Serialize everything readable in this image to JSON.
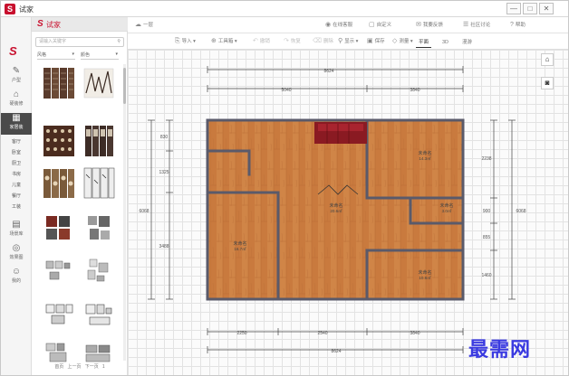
{
  "app": {
    "title": "试家",
    "logo_letter": "S"
  },
  "window_controls": [
    "—",
    "□",
    "✕"
  ],
  "sidebar": {
    "logo": "S",
    "items": [
      {
        "icon": "✎",
        "label": "户型"
      },
      {
        "icon": "⌂",
        "label": "硬装修"
      },
      {
        "icon": "▦",
        "label": "家居装"
      },
      {
        "icon": "▤",
        "label": "场景库"
      },
      {
        "icon": "◎",
        "label": "效果图"
      },
      {
        "icon": "☺",
        "label": "我的"
      }
    ],
    "sub_items": [
      "客厅",
      "卧室",
      "厨卫",
      "书房",
      "儿童",
      "餐厅",
      "工装"
    ]
  },
  "catalog": {
    "search_placeholder": "请输入关键字",
    "filter_style": "风格",
    "filter_color": "颜色",
    "pager": {
      "first": "首页",
      "prev": "上一页",
      "next": "下一页",
      "page": "1"
    }
  },
  "toolbar": {
    "project": "一层",
    "menu": [
      {
        "icon": "◉",
        "label": "在线客服"
      },
      {
        "icon": "▢",
        "label": "自定义"
      },
      {
        "icon": "✉",
        "label": "我要反馈"
      },
      {
        "icon": "☰",
        "label": "社区讨论"
      },
      {
        "icon": "?",
        "label": "帮助"
      }
    ],
    "tools": [
      {
        "icon": "⎘",
        "label": "导入",
        "dim": false
      },
      {
        "icon": "⊕",
        "label": "工具箱",
        "dim": false
      },
      {
        "icon": "↶",
        "label": "撤销",
        "dim": true
      },
      {
        "icon": "↷",
        "label": "恢复",
        "dim": true
      },
      {
        "icon": "⌫",
        "label": "删除",
        "dim": true
      },
      {
        "icon": "⚲",
        "label": "显示",
        "dim": false
      },
      {
        "icon": "▣",
        "label": "保存",
        "dim": false
      },
      {
        "icon": "◇",
        "label": "测量",
        "dim": false
      }
    ],
    "view_tabs": [
      "平面",
      "3D",
      "漫游"
    ]
  },
  "floorplan": {
    "top_dims": {
      "total": "8624",
      "left": "5040",
      "right": "3840"
    },
    "bottom_dims": {
      "total": "8624",
      "seg1": "2250",
      "seg2": "2540",
      "seg3": "3840"
    },
    "left_dims": {
      "total": "6068",
      "seg1": "830",
      "seg2": "1325",
      "seg3": "3488"
    },
    "right_dims": {
      "total": "6068",
      "seg1": "2238",
      "seg2": "900",
      "seg3": "855",
      "seg4": "1460"
    },
    "rooms": [
      {
        "name": "未命名",
        "area": "14.3㎡"
      },
      {
        "name": "未命名",
        "area": "20.6㎡"
      },
      {
        "name": "未命名",
        "area": "3.0㎡"
      },
      {
        "name": "未命名",
        "area": "16.7㎡"
      },
      {
        "name": "未命名",
        "area": "10.8㎡"
      }
    ]
  },
  "canvas_tools": [
    "⌂",
    "◙"
  ],
  "watermark": "最需网"
}
